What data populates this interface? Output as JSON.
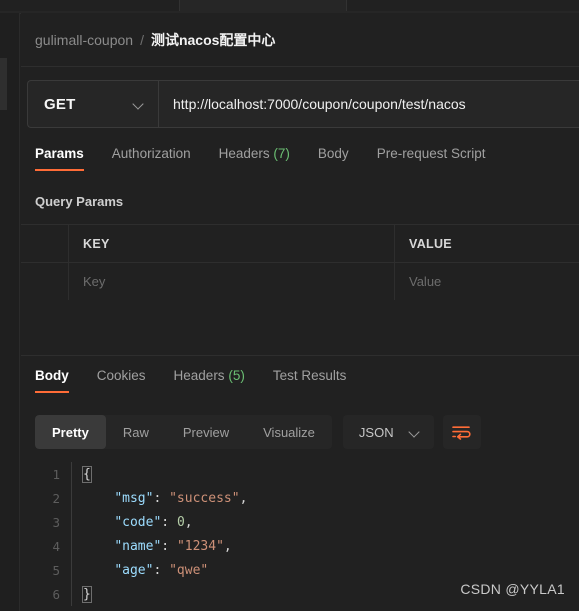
{
  "window": {
    "background": "#212121",
    "accent": "#ff6c37"
  },
  "tabstrip": {
    "tab_left_label": "",
    "tab_right_label": ""
  },
  "breadcrumb": {
    "parent": "gulimall-coupon",
    "separator": "/",
    "current": "测试nacos配置中心"
  },
  "request": {
    "method": "GET",
    "method_chevron_icon": "chevron-down-icon",
    "url": "http://localhost:7000/coupon/coupon/test/nacos",
    "tabs": [
      {
        "label": "Params",
        "active": true,
        "count": ""
      },
      {
        "label": "Authorization",
        "active": false,
        "count": ""
      },
      {
        "label": "Headers",
        "active": false,
        "count": "(7)"
      },
      {
        "label": "Body",
        "active": false,
        "count": ""
      },
      {
        "label": "Pre-request Script",
        "active": false,
        "count": ""
      }
    ],
    "query_params_title": "Query Params",
    "table": {
      "headers": {
        "key": "KEY",
        "value": "VALUE"
      },
      "rows": [
        {
          "key_placeholder": "Key",
          "value_placeholder": "Value"
        }
      ]
    }
  },
  "response": {
    "tabs": [
      {
        "label": "Body",
        "active": true,
        "count": ""
      },
      {
        "label": "Cookies",
        "active": false,
        "count": ""
      },
      {
        "label": "Headers",
        "active": false,
        "count": "(5)"
      },
      {
        "label": "Test Results",
        "active": false,
        "count": ""
      }
    ],
    "view_modes": [
      {
        "label": "Pretty",
        "active": true
      },
      {
        "label": "Raw",
        "active": false
      },
      {
        "label": "Preview",
        "active": false
      },
      {
        "label": "Visualize",
        "active": false
      }
    ],
    "format": {
      "label": "JSON",
      "chevron_icon": "chevron-down-icon"
    },
    "wrap_button_icon": "text-wrap-icon",
    "body_lines": [
      {
        "no": "1",
        "indent": 0,
        "tokens": [
          {
            "t": "brace",
            "v": "{"
          }
        ]
      },
      {
        "no": "2",
        "indent": 1,
        "tokens": [
          {
            "t": "key",
            "v": "\"msg\""
          },
          {
            "t": "punct",
            "v": ": "
          },
          {
            "t": "str",
            "v": "\"success\""
          },
          {
            "t": "punct",
            "v": ","
          }
        ]
      },
      {
        "no": "3",
        "indent": 1,
        "tokens": [
          {
            "t": "key",
            "v": "\"code\""
          },
          {
            "t": "punct",
            "v": ": "
          },
          {
            "t": "num",
            "v": "0"
          },
          {
            "t": "punct",
            "v": ","
          }
        ]
      },
      {
        "no": "4",
        "indent": 1,
        "tokens": [
          {
            "t": "key",
            "v": "\"name\""
          },
          {
            "t": "punct",
            "v": ": "
          },
          {
            "t": "str",
            "v": "\"1234\""
          },
          {
            "t": "punct",
            "v": ","
          }
        ]
      },
      {
        "no": "5",
        "indent": 1,
        "tokens": [
          {
            "t": "key",
            "v": "\"age\""
          },
          {
            "t": "punct",
            "v": ": "
          },
          {
            "t": "str",
            "v": "\"qwe\""
          }
        ]
      },
      {
        "no": "6",
        "indent": 0,
        "tokens": [
          {
            "t": "brace",
            "v": "}"
          }
        ]
      }
    ]
  },
  "watermark": {
    "text": "CSDN @YYLA1"
  }
}
